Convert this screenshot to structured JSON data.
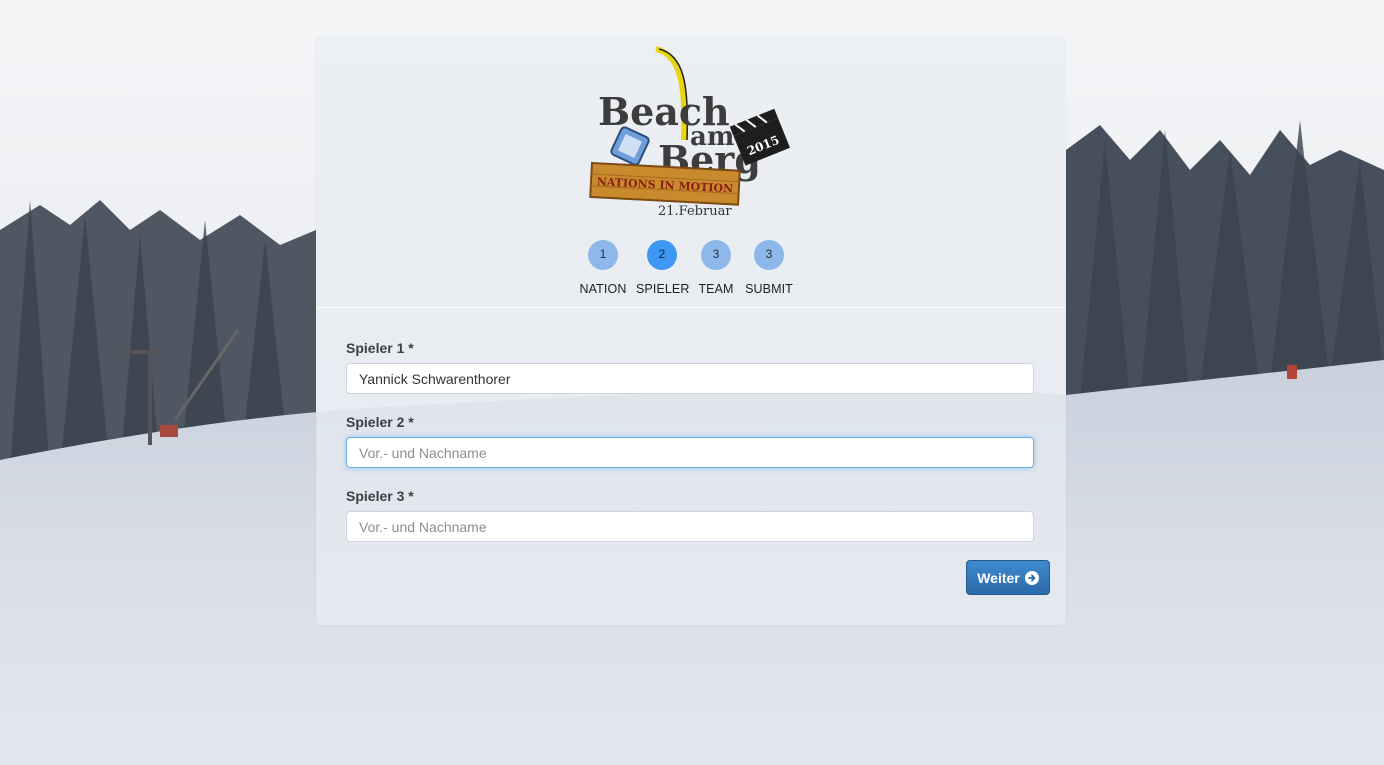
{
  "logo": {
    "word_beach": "Beach",
    "word_am": "am",
    "word_berg": "Berg",
    "banner": "NATIONS IN MOTION",
    "date": "21.Februar",
    "year": "2015"
  },
  "steps": [
    {
      "number": "1",
      "label": "NATION",
      "active": false
    },
    {
      "number": "2",
      "label": "SPIELER",
      "active": true
    },
    {
      "number": "3",
      "label": "TEAM",
      "active": false
    },
    {
      "number": "3",
      "label": "SUBMIT",
      "active": false
    }
  ],
  "form": {
    "player1": {
      "label": "Spieler 1 *",
      "value": "Yannick Schwarenthorer",
      "placeholder": "Vor.- und Nachname"
    },
    "player2": {
      "label": "Spieler 2 *",
      "value": "",
      "placeholder": "Vor.- und Nachname"
    },
    "player3": {
      "label": "Spieler 3 *",
      "value": "",
      "placeholder": "Vor.- und Nachname"
    }
  },
  "buttons": {
    "next_label": "Weiter",
    "next_icon": "arrow-circle-right-icon"
  },
  "colors": {
    "accent": "#3d97f5",
    "button": "#337ab7",
    "step_inactive": "#8bb7e6"
  }
}
